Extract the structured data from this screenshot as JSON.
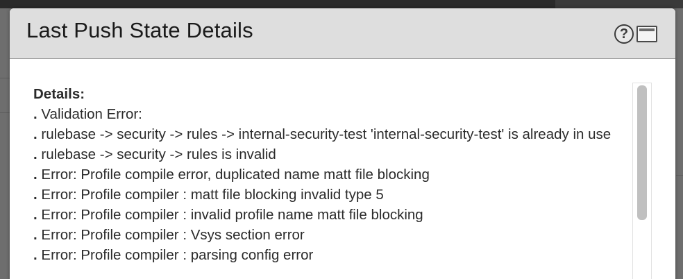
{
  "modal": {
    "title": "Last Push State Details",
    "help_icon_glyph": "?",
    "help_icon": "help-icon",
    "maximize_icon": "maximize-icon"
  },
  "details": {
    "heading": "Details:",
    "bullet": ".",
    "lines": [
      "Validation Error:",
      "rulebase -> security -> rules -> internal-security-test 'internal-security-test' is already in use",
      "rulebase -> security -> rules is invalid",
      "Error: Profile compile error, duplicated name matt file blocking",
      "Error: Profile compiler : matt file blocking invalid type 5",
      "Error: Profile compiler : invalid profile name matt file blocking",
      "Error: Profile compiler : Vsys section error",
      "Error: Profile compiler : parsing config error"
    ]
  },
  "colors": {
    "header_bg": "#dedede",
    "overlay_bg": "#6e6e6e",
    "scroll_thumb": "#c0c0c0"
  }
}
